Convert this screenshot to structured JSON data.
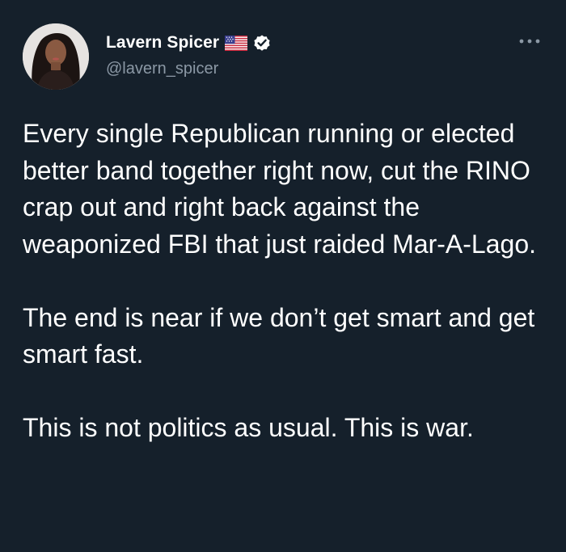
{
  "author": {
    "display_name": "Lavern Spicer",
    "handle": "@lavern_spicer",
    "flag_icon": "us-flag-icon",
    "verified_icon": "verified-badge-icon",
    "verified_color": "#ffffff"
  },
  "more_icon": "more-options-icon",
  "tweet": {
    "paragraphs": [
      "Every single Republican running or elected better band together right now, cut the RINO crap out and right back against the weaponized FBI that just raided Mar-A-Lago.",
      "The end is near if we don’t get smart and get smart fast.",
      "This is not politics as usual. This is war."
    ]
  },
  "colors": {
    "background": "#15202b",
    "text": "#ffffff",
    "secondary_text": "#8b98a5"
  }
}
